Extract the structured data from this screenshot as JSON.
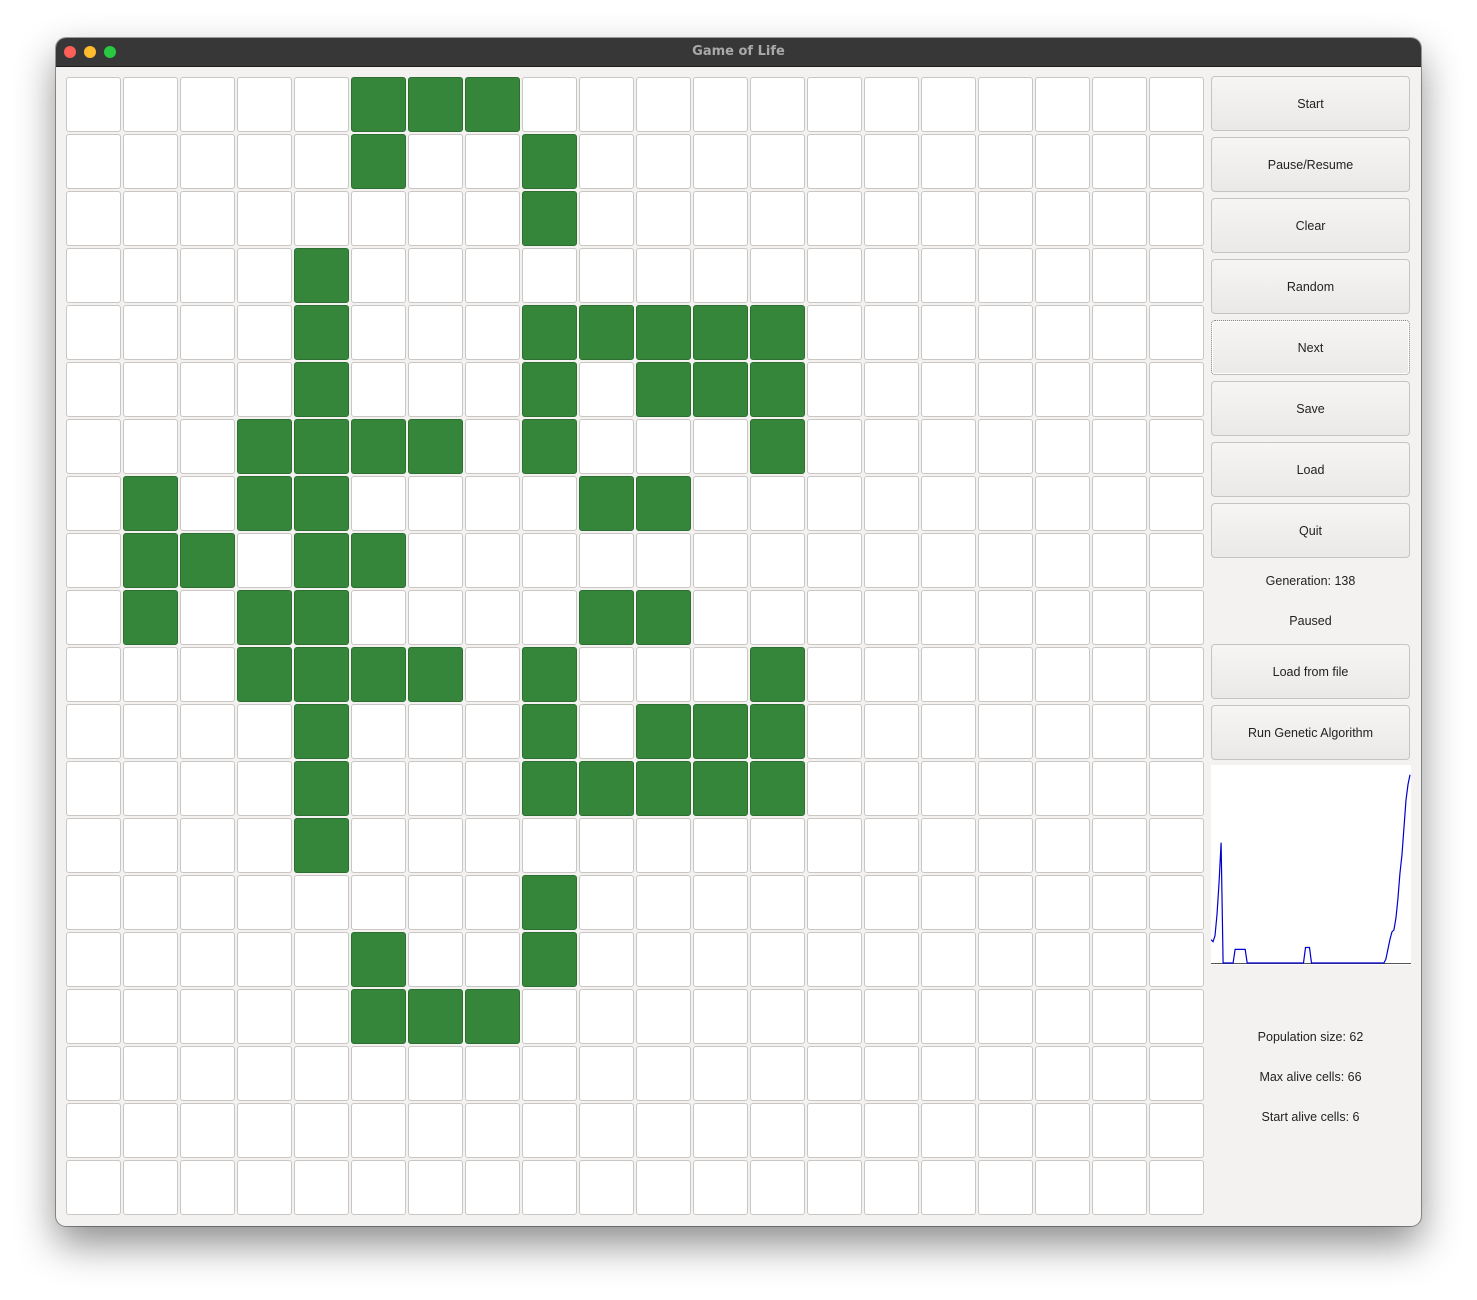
{
  "window": {
    "title": "Game of Life"
  },
  "grid": {
    "rows": 20,
    "cols": 20,
    "alive_color": "#35863a",
    "dead_color": "#ffffff",
    "alive_cells": [
      [
        0,
        5
      ],
      [
        0,
        6
      ],
      [
        0,
        7
      ],
      [
        1,
        5
      ],
      [
        1,
        8
      ],
      [
        2,
        8
      ],
      [
        3,
        4
      ],
      [
        4,
        4
      ],
      [
        4,
        8
      ],
      [
        4,
        9
      ],
      [
        4,
        10
      ],
      [
        4,
        11
      ],
      [
        4,
        12
      ],
      [
        5,
        4
      ],
      [
        5,
        8
      ],
      [
        5,
        10
      ],
      [
        5,
        11
      ],
      [
        5,
        12
      ],
      [
        6,
        3
      ],
      [
        6,
        4
      ],
      [
        6,
        5
      ],
      [
        6,
        6
      ],
      [
        6,
        8
      ],
      [
        6,
        12
      ],
      [
        7,
        1
      ],
      [
        7,
        3
      ],
      [
        7,
        4
      ],
      [
        7,
        9
      ],
      [
        7,
        10
      ],
      [
        8,
        1
      ],
      [
        8,
        2
      ],
      [
        8,
        4
      ],
      [
        8,
        5
      ],
      [
        9,
        1
      ],
      [
        9,
        3
      ],
      [
        9,
        4
      ],
      [
        9,
        9
      ],
      [
        9,
        10
      ],
      [
        10,
        3
      ],
      [
        10,
        4
      ],
      [
        10,
        5
      ],
      [
        10,
        6
      ],
      [
        10,
        8
      ],
      [
        10,
        12
      ],
      [
        11,
        4
      ],
      [
        11,
        8
      ],
      [
        11,
        10
      ],
      [
        11,
        11
      ],
      [
        11,
        12
      ],
      [
        12,
        4
      ],
      [
        12,
        8
      ],
      [
        12,
        9
      ],
      [
        12,
        10
      ],
      [
        12,
        11
      ],
      [
        12,
        12
      ],
      [
        13,
        4
      ],
      [
        14,
        8
      ],
      [
        15,
        5
      ],
      [
        15,
        8
      ],
      [
        16,
        5
      ],
      [
        16,
        6
      ],
      [
        16,
        7
      ]
    ]
  },
  "controls": {
    "start": "Start",
    "pause_resume": "Pause/Resume",
    "clear": "Clear",
    "random": "Random",
    "next": "Next",
    "save": "Save",
    "load": "Load",
    "quit": "Quit",
    "load_from_file": "Load from file",
    "run_genetic_algorithm": "Run Genetic Algorithm"
  },
  "status": {
    "generation": "Generation: 138",
    "state": "Paused"
  },
  "stats": {
    "population_size": "Population size: 62",
    "max_alive_cells": "Max alive cells: 66",
    "start_alive_cells": "Start alive cells: 6"
  },
  "chart_data": {
    "type": "line",
    "line_color": "#0000cc",
    "x": [
      0,
      1,
      2,
      3,
      4,
      5,
      6,
      7,
      8,
      9,
      10,
      11,
      12,
      13,
      14,
      15,
      16,
      17,
      18,
      19,
      20,
      21,
      22,
      23,
      24,
      25,
      26,
      27,
      28,
      29,
      30,
      31,
      32,
      33,
      34,
      35,
      36,
      37,
      38,
      39,
      40,
      41,
      42,
      43,
      44,
      45,
      46,
      47,
      48,
      49,
      50,
      51,
      52,
      53,
      54,
      55,
      56,
      57,
      58,
      59,
      60,
      61,
      62,
      63,
      64,
      65,
      66,
      67,
      68,
      69,
      70,
      71,
      72,
      73,
      74,
      75,
      76,
      77,
      78,
      79,
      80,
      81,
      82,
      83,
      84,
      85,
      86,
      87,
      88,
      89,
      90,
      91,
      92,
      93,
      94,
      95,
      96,
      97,
      98,
      99
    ],
    "series": [
      {
        "values": [
          12,
          11,
          14,
          25,
          41,
          62,
          0,
          0,
          0,
          0,
          0,
          0,
          7,
          7,
          7,
          7,
          7,
          7,
          0,
          0,
          0,
          0,
          0,
          0,
          0,
          0,
          0,
          0,
          0,
          0,
          0,
          0,
          0,
          0,
          0,
          0,
          0,
          0,
          0,
          0,
          0,
          0,
          0,
          0,
          0,
          0,
          0,
          8,
          8,
          8,
          0,
          0,
          0,
          0,
          0,
          0,
          0,
          0,
          0,
          0,
          0,
          0,
          0,
          0,
          0,
          0,
          0,
          0,
          0,
          0,
          0,
          0,
          0,
          0,
          0,
          0,
          0,
          0,
          0,
          0,
          0,
          0,
          0,
          0,
          0,
          0,
          0,
          2,
          7,
          12,
          16,
          17,
          23,
          33,
          46,
          56,
          70,
          84,
          92,
          97
        ]
      }
    ],
    "ylim": [
      0,
      100
    ]
  }
}
